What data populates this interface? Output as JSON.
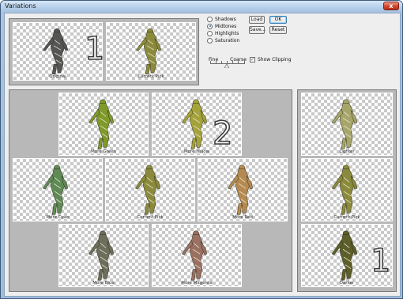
{
  "window": {
    "title": "Variations",
    "close_glyph": "x"
  },
  "original_thumbs": [
    {
      "caption": "Original",
      "tint": "gray"
    },
    {
      "caption": "Current Pick",
      "tint": "olive"
    }
  ],
  "tone_options": [
    {
      "label": "Shadows",
      "selected": false
    },
    {
      "label": "Midtones",
      "selected": true
    },
    {
      "label": "Highlights",
      "selected": false
    },
    {
      "label": "Saturation",
      "selected": false
    }
  ],
  "buttons": {
    "load": "Load",
    "ok": "OK",
    "save": "Save...",
    "reset": "Reset"
  },
  "slider": {
    "fine_label": "Fine",
    "coarse_label": "Coarse",
    "level_fraction": 0.5
  },
  "show_clipping": {
    "label": "Show Clipping",
    "checked": true
  },
  "color_thumbs": [
    {
      "caption": "More Green",
      "tint": "green"
    },
    {
      "caption": "More Yellow",
      "tint": "yellow"
    },
    {
      "caption": "More Cyan",
      "tint": "cyan"
    },
    {
      "caption": "Current Pick",
      "tint": "olive"
    },
    {
      "caption": "More Red",
      "tint": "red"
    },
    {
      "caption": "More Blue",
      "tint": "blue"
    },
    {
      "caption": "More Magenta",
      "tint": "magenta"
    }
  ],
  "brightness_thumbs": [
    {
      "caption": "Lighter",
      "tint": "light"
    },
    {
      "caption": "Current Pick",
      "tint": "olive"
    },
    {
      "caption": "Darker",
      "tint": "dark"
    }
  ],
  "annotations": {
    "one": "1",
    "two": "2",
    "one_side": "1"
  },
  "colors": {
    "gray": "#555555",
    "olive": "#8b8a3c",
    "green": "#7f9a2a",
    "yellow": "#a4a23b",
    "cyan": "#5f8a55",
    "red": "#b58a52",
    "blue": "#6e6e5c",
    "magenta": "#9a7062",
    "light": "#a6a66a",
    "dark": "#5e5e2a"
  }
}
